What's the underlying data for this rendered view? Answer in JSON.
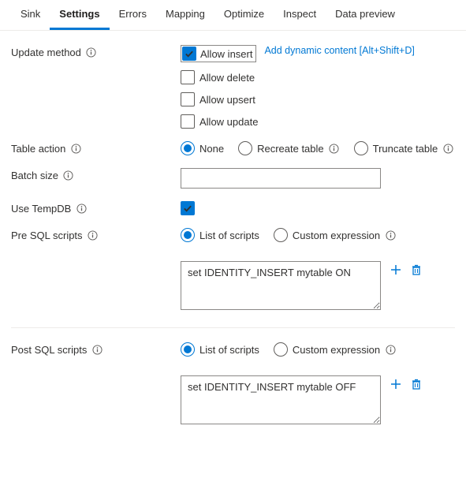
{
  "tabs": {
    "items": [
      {
        "label": "Sink"
      },
      {
        "label": "Settings"
      },
      {
        "label": "Errors"
      },
      {
        "label": "Mapping"
      },
      {
        "label": "Optimize"
      },
      {
        "label": "Inspect"
      },
      {
        "label": "Data preview"
      }
    ],
    "active_index": 1
  },
  "settings": {
    "update_method": {
      "label": "Update method",
      "allow_insert": {
        "label": "Allow insert",
        "checked": true
      },
      "allow_delete": {
        "label": "Allow delete",
        "checked": false
      },
      "allow_upsert": {
        "label": "Allow upsert",
        "checked": false
      },
      "allow_update": {
        "label": "Allow update",
        "checked": false
      },
      "dynamic_link": "Add dynamic content [Alt+Shift+D]"
    },
    "table_action": {
      "label": "Table action",
      "options": {
        "none": "None",
        "recreate": "Recreate table",
        "truncate": "Truncate table"
      },
      "selected": "none"
    },
    "batch_size": {
      "label": "Batch size",
      "value": ""
    },
    "use_tempdb": {
      "label": "Use TempDB",
      "checked": true
    },
    "pre_sql": {
      "label": "Pre SQL scripts",
      "mode_options": {
        "list": "List of scripts",
        "expr": "Custom expression"
      },
      "mode_selected": "list",
      "script": "set IDENTITY_INSERT mytable ON"
    },
    "post_sql": {
      "label": "Post SQL scripts",
      "mode_options": {
        "list": "List of scripts",
        "expr": "Custom expression"
      },
      "mode_selected": "list",
      "script": "set IDENTITY_INSERT mytable OFF"
    }
  }
}
